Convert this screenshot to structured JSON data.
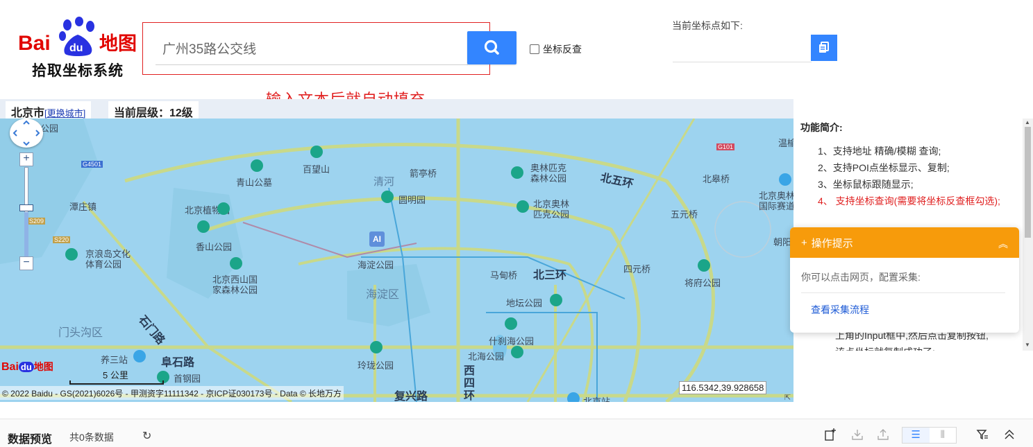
{
  "header": {
    "logo_bai": "Bai",
    "logo_du": "du",
    "logo_ditu": "地图",
    "logo_subtitle": "拾取坐标系统",
    "search_value": "广州35路公交线",
    "reverse_label": "坐标反查",
    "annotation": "输入文本后就自动填充",
    "coord_label": "当前坐标点如下:",
    "coord_value": ""
  },
  "citybar": {
    "city": "北京市",
    "change_city": "[更换城市]",
    "level": "当前层级：12级"
  },
  "map": {
    "pois": [
      {
        "label": "奥林匹克",
        "label2": "森林公园"
      },
      {
        "label": "百望山"
      },
      {
        "label": "青山公墓"
      },
      {
        "label": "清河"
      },
      {
        "label": "圆明园"
      },
      {
        "label": "北京植物园"
      },
      {
        "label": "北京奥林",
        "label2": "匹克公园"
      },
      {
        "label": "香山公园"
      },
      {
        "label": "京浪岛文化",
        "label2": "体育公园"
      },
      {
        "label": "海淀公园"
      },
      {
        "label": "北京西山国",
        "label2": "家森林公园"
      },
      {
        "label": "地坛公园"
      },
      {
        "label": "什刹海公园"
      },
      {
        "label": "北海公园"
      },
      {
        "label": "玲珑公园"
      },
      {
        "label": "首钢园"
      },
      {
        "label": "将府公园"
      },
      {
        "label": "北京奥林匹克",
        "label2": "国际赛道"
      },
      {
        "label": "森林公园"
      },
      {
        "label": "北京站"
      },
      {
        "label": "养三站"
      },
      {
        "label": "门头沟区"
      },
      {
        "label": "海淀区"
      },
      {
        "label": "北皋桥"
      },
      {
        "label": "五元桥"
      },
      {
        "label": "四元桥"
      },
      {
        "label": "马甸桥"
      },
      {
        "label": "箭亭桥"
      },
      {
        "label": "潭庄镇"
      },
      {
        "label": "朝阳"
      },
      {
        "label": "温榆"
      }
    ],
    "roads": [
      {
        "label": "北五环"
      },
      {
        "label": "北三环"
      },
      {
        "label": "石门路"
      },
      {
        "label": "阜石路"
      },
      {
        "label": "西四环"
      },
      {
        "label": "复兴路"
      }
    ],
    "highway_tags": [
      "G4501",
      "G101",
      "S209",
      "S220"
    ],
    "scale": "5 公里",
    "copyright": "© 2022 Baidu - GS(2021)6026号 - 甲测资字11111342 - 京ICP证030173号 - Data © 长地万方",
    "cursor_coord": "116.5342,39.928658"
  },
  "panel": {
    "title": "功能简介:",
    "items": [
      "1、支持地址 精确/模糊 查询;",
      "2、支持POI点坐标显示、复制;",
      "3、坐标鼠标跟随显示;",
      "4、 支持坐标查询(需要将坐标反查框勾选);"
    ],
    "tail1": "上角的Input框中,然后点击复制按钮,",
    "tail2": "该点坐标就复制成功了;"
  },
  "popup": {
    "title": "操作提示",
    "body": "你可以点击网页，配置采集:",
    "link": "查看采集流程"
  },
  "bottombar": {
    "title": "数据预览",
    "count": "共0条数据"
  },
  "colors": {
    "accent": "#3385ff",
    "annotation_red": "#e02020",
    "popup_orange": "#f79b0b",
    "map_water": "#9dd3ef"
  }
}
